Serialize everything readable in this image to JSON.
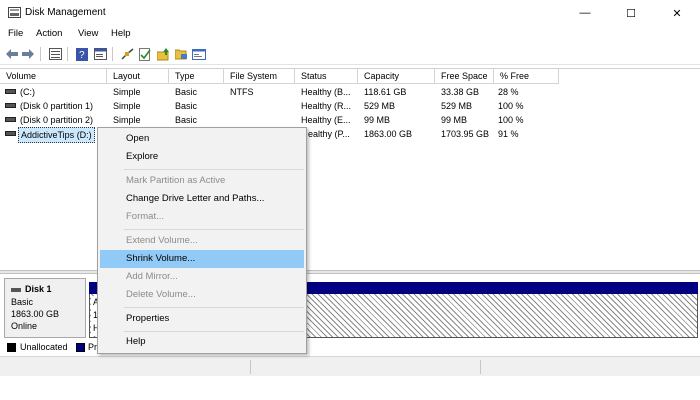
{
  "window": {
    "title": "Disk Management",
    "controls": {
      "minimize": "—",
      "maximize": "☐",
      "close": "✕"
    }
  },
  "menu": {
    "items": [
      "File",
      "Action",
      "View",
      "Help"
    ]
  },
  "toolbar": {
    "icons": [
      "back-icon",
      "forward-icon",
      "list-view-icon",
      "help-book-icon",
      "properties-icon",
      "connect-icon",
      "check-icon",
      "folder-up-icon",
      "folder-open-icon",
      "window-icon"
    ]
  },
  "volume_table": {
    "columns": [
      "Volume",
      "Layout",
      "Type",
      "File System",
      "Status",
      "Capacity",
      "Free Space",
      "% Free"
    ],
    "rows": [
      {
        "volume": "(C:)",
        "layout": "Simple",
        "type": "Basic",
        "fs": "NTFS",
        "status": "Healthy (B...",
        "capacity": "118.61 GB",
        "free": "33.38 GB",
        "pct": "28 %"
      },
      {
        "volume": "(Disk 0 partition 1)",
        "layout": "Simple",
        "type": "Basic",
        "fs": "",
        "status": "Healthy (R...",
        "capacity": "529 MB",
        "free": "529 MB",
        "pct": "100 %"
      },
      {
        "volume": "(Disk 0 partition 2)",
        "layout": "Simple",
        "type": "Basic",
        "fs": "",
        "status": "Healthy (E...",
        "capacity": "99 MB",
        "free": "99 MB",
        "pct": "100 %"
      },
      {
        "volume": "AddictiveTips (D:)",
        "layout": "",
        "type": "",
        "fs": "",
        "status": "ealthy (P...",
        "capacity": "1863.00 GB",
        "free": "1703.95 GB",
        "pct": "91 %"
      }
    ]
  },
  "disk": {
    "name": "Disk 1",
    "type": "Basic",
    "size": "1863.00 GB",
    "state": "Online",
    "partition_fragment": "A\n1\nH"
  },
  "legend": {
    "items": [
      "Unallocated",
      "Pr"
    ]
  },
  "context_menu": {
    "items": [
      {
        "label": "Open",
        "enabled": true
      },
      {
        "label": "Explore",
        "enabled": true
      },
      {
        "label": "Mark Partition as Active",
        "enabled": false
      },
      {
        "label": "Change Drive Letter and Paths...",
        "enabled": true
      },
      {
        "label": "Format...",
        "enabled": false
      },
      {
        "label": "Extend Volume...",
        "enabled": false
      },
      {
        "label": "Shrink Volume...",
        "enabled": true,
        "highlighted": true
      },
      {
        "label": "Add Mirror...",
        "enabled": false
      },
      {
        "label": "Delete Volume...",
        "enabled": false
      },
      {
        "label": "Properties",
        "enabled": true
      },
      {
        "label": "Help",
        "enabled": true
      }
    ]
  },
  "colors": {
    "selection": "#cce8ff",
    "menu_highlight": "#91c9f7",
    "primary_partition": "#000080",
    "unallocated": "#000000"
  }
}
